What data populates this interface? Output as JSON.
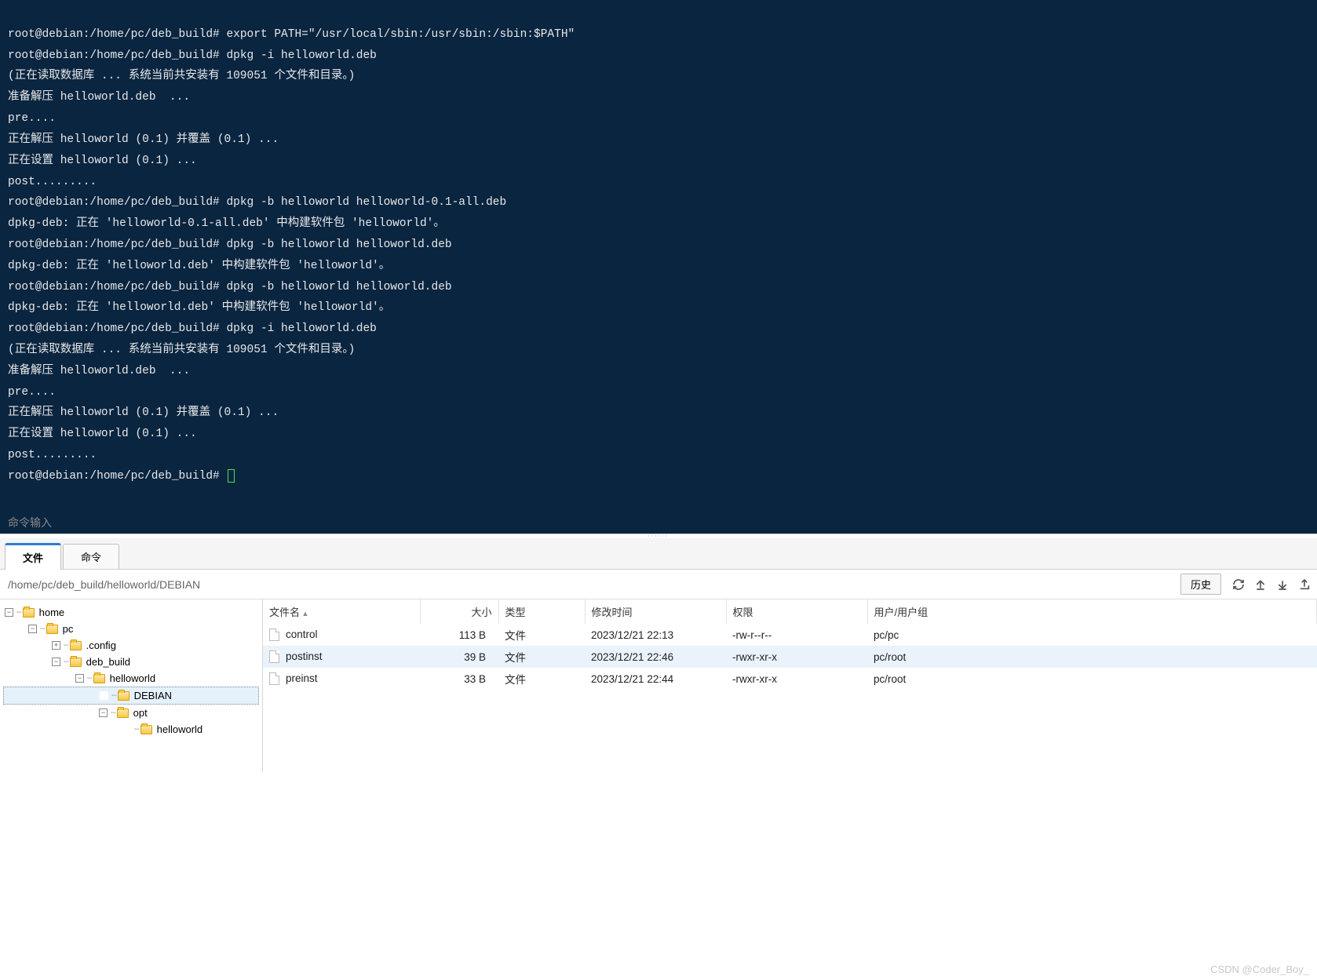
{
  "terminal": {
    "lines": [
      "root@debian:/home/pc/deb_build# export PATH=\"/usr/local/sbin:/usr/sbin:/sbin:$PATH\"",
      "root@debian:/home/pc/deb_build# dpkg -i helloworld.deb",
      "(正在读取数据库 ... 系统当前共安装有 109051 个文件和目录。)",
      "准备解压 helloworld.deb  ...",
      "pre....",
      "正在解压 helloworld (0.1) 并覆盖 (0.1) ...",
      "正在设置 helloworld (0.1) ...",
      "post.........",
      "root@debian:/home/pc/deb_build# dpkg -b helloworld helloworld-0.1-all.deb",
      "dpkg-deb: 正在 'helloworld-0.1-all.deb' 中构建软件包 'helloworld'。",
      "root@debian:/home/pc/deb_build# dpkg -b helloworld helloworld.deb",
      "dpkg-deb: 正在 'helloworld.deb' 中构建软件包 'helloworld'。",
      "root@debian:/home/pc/deb_build# dpkg -b helloworld helloworld.deb",
      "dpkg-deb: 正在 'helloworld.deb' 中构建软件包 'helloworld'。",
      "root@debian:/home/pc/deb_build# dpkg -i helloworld.deb",
      "(正在读取数据库 ... 系统当前共安装有 109051 个文件和目录。)",
      "准备解压 helloworld.deb  ...",
      "pre....",
      "正在解压 helloworld (0.1) 并覆盖 (0.1) ...",
      "正在设置 helloworld (0.1) ...",
      "post.........",
      "root@debian:/home/pc/deb_build# "
    ],
    "input_hint": "命令输入"
  },
  "tabs": {
    "files": "文件",
    "commands": "命令"
  },
  "toolbar": {
    "path": "/home/pc/deb_build/helloworld/DEBIAN",
    "history": "历史"
  },
  "tree": {
    "n0": "home",
    "n1": "pc",
    "n2": ".config",
    "n3": "deb_build",
    "n4": "helloworld",
    "n5": "DEBIAN",
    "n6": "opt",
    "n7": "helloworld"
  },
  "list": {
    "headers": {
      "name": "文件名",
      "size": "大小",
      "type": "类型",
      "mtime": "修改时间",
      "perm": "权限",
      "owner": "用户/用户组"
    },
    "rows": [
      {
        "name": "control",
        "size": "113 B",
        "type": "文件",
        "mtime": "2023/12/21 22:13",
        "perm": "-rw-r--r--",
        "owner": "pc/pc"
      },
      {
        "name": "postinst",
        "size": "39 B",
        "type": "文件",
        "mtime": "2023/12/21 22:46",
        "perm": "-rwxr-xr-x",
        "owner": "pc/root"
      },
      {
        "name": "preinst",
        "size": "33 B",
        "type": "文件",
        "mtime": "2023/12/21 22:44",
        "perm": "-rwxr-xr-x",
        "owner": "pc/root"
      }
    ]
  },
  "watermark": "CSDN @Coder_Boy_"
}
